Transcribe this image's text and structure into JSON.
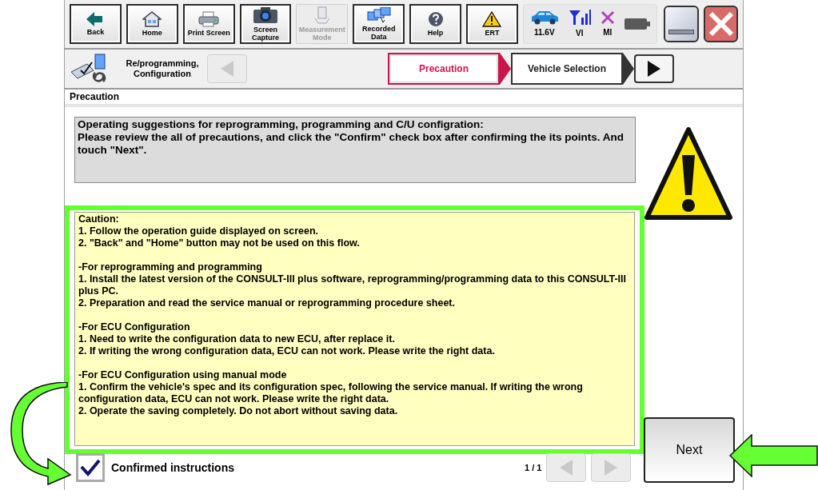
{
  "toolbar": [
    {
      "kind": "back",
      "label": "Back",
      "disabled": false
    },
    {
      "kind": "home",
      "label": "Home",
      "disabled": false
    },
    {
      "kind": "print",
      "label": "Print Screen",
      "disabled": false
    },
    {
      "kind": "camera",
      "label": "Screen Capture",
      "disabled": false
    },
    {
      "kind": "measure",
      "label": "Measurement Mode",
      "disabled": true
    },
    {
      "kind": "recorded",
      "label": "Recorded Data",
      "disabled": false
    },
    {
      "kind": "help",
      "label": "Help",
      "disabled": false
    },
    {
      "kind": "ert",
      "label": "ERT",
      "disabled": false
    }
  ],
  "status": [
    {
      "kind": "car",
      "label": "11.6V"
    },
    {
      "kind": "signal",
      "label": "VI"
    },
    {
      "kind": "cross",
      "label": "MI"
    },
    {
      "kind": "battery"
    }
  ],
  "nav": {
    "mode": "Re/programming, Configuration",
    "back_disabled": true,
    "steps": [
      {
        "label": "Precaution",
        "selected": true
      },
      {
        "label": "Vehicle Selection",
        "selected": false
      }
    ]
  },
  "section_title": "Precaution",
  "intro": [
    "Operating suggestions for reprogramming, programming and C/U configration:",
    "Please review the all of precautions, and click the \"Confirm\" check box after confirming the its points. And touch \"Next\"."
  ],
  "caution": [
    [
      "Caution:",
      "1. Follow the operation guide displayed on screen.",
      "2. \"Back\" and  \"Home\" button may not be used on this flow."
    ],
    [
      "-For reprogramming and programming",
      "1. Install the latest version of the CONSULT-III plus software, reprogramming/programming data to this CONSULT-III plus PC.",
      "2. Preparation and read the service manual or reprogramming procedure sheet."
    ],
    [
      "-For ECU Configuration",
      "1. Need to write the configuration data to new ECU, after replace it.",
      "2. If writing the wrong configuration data, ECU can not work. Please write the right data."
    ],
    [
      "-For ECU Configuration using manual mode",
      "1. Confirm the vehicle's spec and its configuration spec, following the service manual.  If writing the wrong configuration data, ECU can not work. Please write the right data.",
      "2. Operate the saving completely. Do not abort without saving data."
    ]
  ],
  "confirm": {
    "label": "Confirmed instructions",
    "checked": true
  },
  "pager": {
    "text": "1 / 1",
    "prev_disabled": true,
    "next_disabled": true
  },
  "next_button": "Next"
}
